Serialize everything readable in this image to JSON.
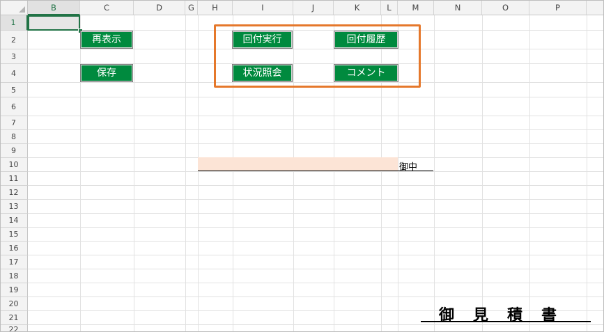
{
  "columns": [
    "B",
    "C",
    "D",
    "G",
    "H",
    "I",
    "J",
    "K",
    "L",
    "M",
    "N",
    "O",
    "P"
  ],
  "selected_column": "B",
  "rows": [
    "1",
    "2",
    "3",
    "4",
    "5",
    "6",
    "7",
    "8",
    "9",
    "10",
    "11",
    "12",
    "13",
    "14",
    "15",
    "16",
    "17",
    "18",
    "19",
    "20",
    "21",
    "22"
  ],
  "selected_row": "1",
  "buttons": {
    "refresh": "再表示",
    "save": "保存",
    "circulate": "回付実行",
    "circulation_history": "回付履歴",
    "status_inquiry": "状況照会",
    "comment": "コメント"
  },
  "recipient_suffix": "御中",
  "document_title": "御見積書",
  "colors": {
    "button_green": "#008a3e",
    "group_frame": "#e5782b",
    "input_fill": "#fce4d6",
    "selection": "#217346"
  }
}
